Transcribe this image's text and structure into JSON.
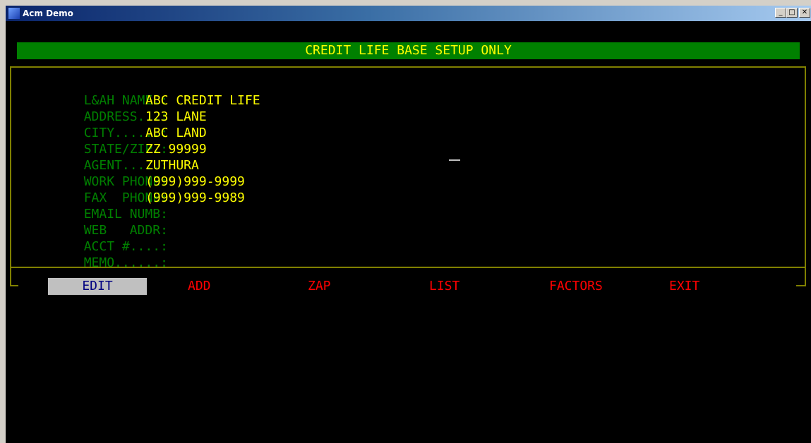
{
  "window": {
    "title": "Acm Demo",
    "min_glyph": "_",
    "max_glyph": "□",
    "close_glyph": "✕"
  },
  "header": {
    "title": "CREDIT LIFE BASE SETUP ONLY"
  },
  "fields": [
    {
      "label": "L&AH NAME.:",
      "value": "ABC CREDIT LIFE"
    },
    {
      "label": "ADDRESS...:",
      "value": "123 LANE"
    },
    {
      "label": "CITY......:",
      "value": "ABC LAND"
    },
    {
      "label": "STATE/ZIP.:",
      "value": "ZZ 99999"
    },
    {
      "label": "AGENT.....:",
      "value": "ZUTHURA"
    },
    {
      "label": "WORK PHONE:",
      "value": "(999)999-9999"
    },
    {
      "label": "FAX  PHONE:",
      "value": "(999)999-9989"
    },
    {
      "label": "EMAIL NUMB:",
      "value": ""
    },
    {
      "label": "WEB   ADDR:",
      "value": ""
    },
    {
      "label": "ACCT #....:",
      "value": ""
    },
    {
      "label": "MEMO......:",
      "value": ""
    }
  ],
  "menu": {
    "edit": "EDIT",
    "add": "ADD",
    "zap": "ZAP",
    "list": "LIST",
    "factors": "FACTORS",
    "exit": "EXIT"
  },
  "colors": {
    "label": "#008000",
    "value": "#ffff00",
    "menu": "#ff0000",
    "selected_bg": "#c0c0c0",
    "selected_fg": "#000080"
  }
}
